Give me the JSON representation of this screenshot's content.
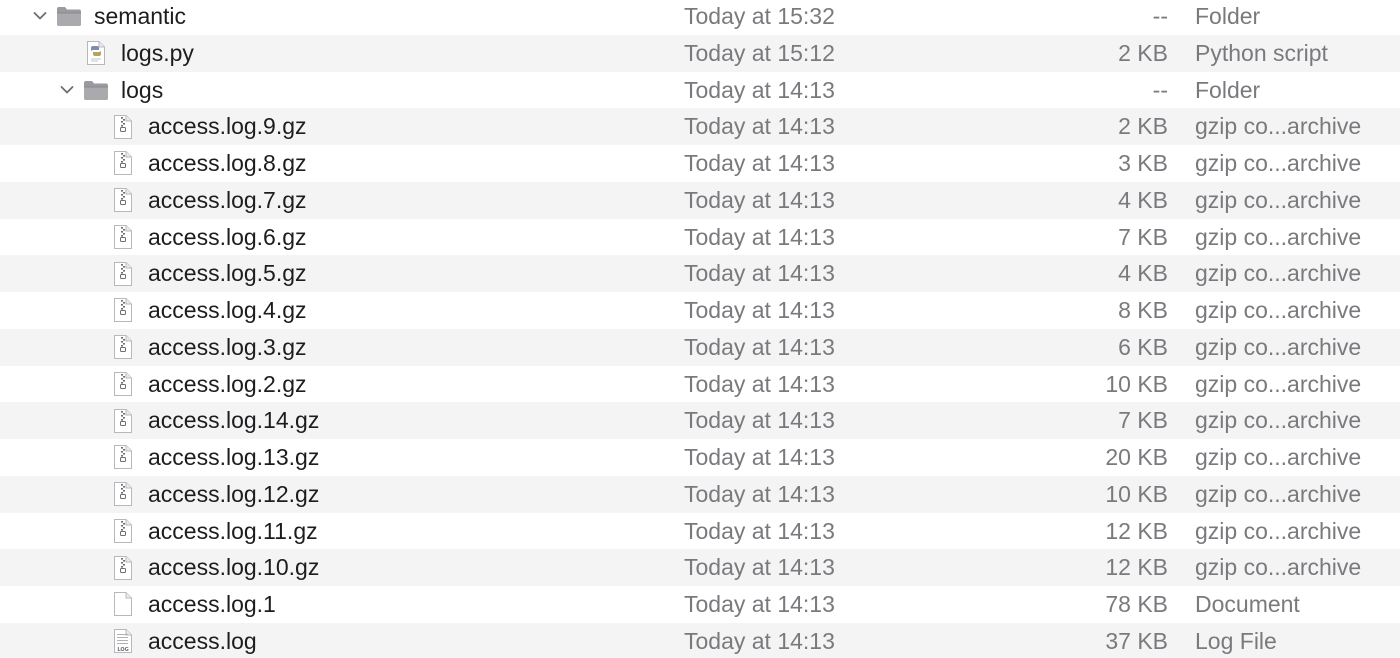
{
  "window": {
    "view": "list"
  },
  "colors": {
    "alt_row": "#f4f4f5",
    "name_text": "#1d1d1f",
    "meta_text": "#7a7a7e",
    "folder_fill": "#8e8e93"
  },
  "rows": [
    {
      "name": "semantic",
      "date": "Today at 15:32",
      "size": "--",
      "kind": "Folder",
      "type": "folder",
      "level": 0,
      "expanded": true,
      "icon": "folder-icon"
    },
    {
      "name": "logs.py",
      "date": "Today at 15:12",
      "size": "2 KB",
      "kind": "Python script",
      "type": "python",
      "level": 1,
      "icon": "python-script-icon"
    },
    {
      "name": "logs",
      "date": "Today at 14:13",
      "size": "--",
      "kind": "Folder",
      "type": "folder",
      "level": 1,
      "expanded": true,
      "icon": "folder-icon"
    },
    {
      "name": "access.log.9.gz",
      "date": "Today at 14:13",
      "size": "2 KB",
      "kind": "gzip co...archive",
      "type": "gzip",
      "level": 2,
      "icon": "gzip-archive-icon"
    },
    {
      "name": "access.log.8.gz",
      "date": "Today at 14:13",
      "size": "3 KB",
      "kind": "gzip co...archive",
      "type": "gzip",
      "level": 2,
      "icon": "gzip-archive-icon"
    },
    {
      "name": "access.log.7.gz",
      "date": "Today at 14:13",
      "size": "4 KB",
      "kind": "gzip co...archive",
      "type": "gzip",
      "level": 2,
      "icon": "gzip-archive-icon"
    },
    {
      "name": "access.log.6.gz",
      "date": "Today at 14:13",
      "size": "7 KB",
      "kind": "gzip co...archive",
      "type": "gzip",
      "level": 2,
      "icon": "gzip-archive-icon"
    },
    {
      "name": "access.log.5.gz",
      "date": "Today at 14:13",
      "size": "4 KB",
      "kind": "gzip co...archive",
      "type": "gzip",
      "level": 2,
      "icon": "gzip-archive-icon"
    },
    {
      "name": "access.log.4.gz",
      "date": "Today at 14:13",
      "size": "8 KB",
      "kind": "gzip co...archive",
      "type": "gzip",
      "level": 2,
      "icon": "gzip-archive-icon"
    },
    {
      "name": "access.log.3.gz",
      "date": "Today at 14:13",
      "size": "6 KB",
      "kind": "gzip co...archive",
      "type": "gzip",
      "level": 2,
      "icon": "gzip-archive-icon"
    },
    {
      "name": "access.log.2.gz",
      "date": "Today at 14:13",
      "size": "10 KB",
      "kind": "gzip co...archive",
      "type": "gzip",
      "level": 2,
      "icon": "gzip-archive-icon"
    },
    {
      "name": "access.log.14.gz",
      "date": "Today at 14:13",
      "size": "7 KB",
      "kind": "gzip co...archive",
      "type": "gzip",
      "level": 2,
      "icon": "gzip-archive-icon"
    },
    {
      "name": "access.log.13.gz",
      "date": "Today at 14:13",
      "size": "20 KB",
      "kind": "gzip co...archive",
      "type": "gzip",
      "level": 2,
      "icon": "gzip-archive-icon"
    },
    {
      "name": "access.log.12.gz",
      "date": "Today at 14:13",
      "size": "10 KB",
      "kind": "gzip co...archive",
      "type": "gzip",
      "level": 2,
      "icon": "gzip-archive-icon"
    },
    {
      "name": "access.log.11.gz",
      "date": "Today at 14:13",
      "size": "12 KB",
      "kind": "gzip co...archive",
      "type": "gzip",
      "level": 2,
      "icon": "gzip-archive-icon"
    },
    {
      "name": "access.log.10.gz",
      "date": "Today at 14:13",
      "size": "12 KB",
      "kind": "gzip co...archive",
      "type": "gzip",
      "level": 2,
      "icon": "gzip-archive-icon"
    },
    {
      "name": "access.log.1",
      "date": "Today at 14:13",
      "size": "78 KB",
      "kind": "Document",
      "type": "document",
      "level": 2,
      "icon": "document-icon"
    },
    {
      "name": "access.log",
      "date": "Today at 14:13",
      "size": "37 KB",
      "kind": "Log File",
      "type": "log",
      "level": 2,
      "icon": "log-file-icon",
      "icon_label": "LOG"
    }
  ]
}
